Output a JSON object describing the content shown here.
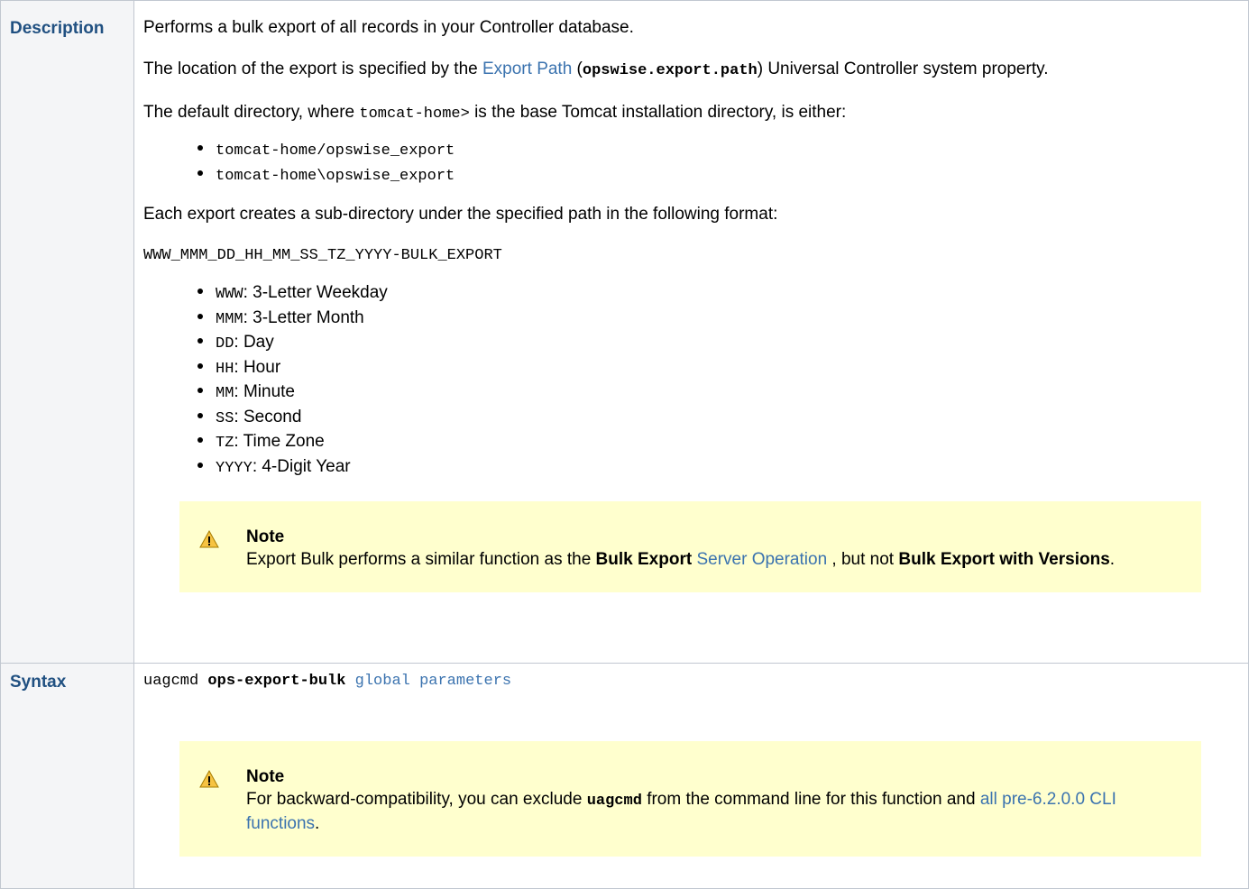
{
  "description": {
    "label": "Description",
    "intro": "Performs a bulk export of all records in your Controller database.",
    "location": {
      "before": "The location of the export is specified by the ",
      "link": "Export Path",
      "paren_open": " (",
      "property": "opswise.export.path",
      "after": ") Universal Controller system property."
    },
    "default_dir": {
      "before": "The default directory, where ",
      "code": "tomcat-home>",
      "after": " is the base Tomcat installation directory, is either:"
    },
    "paths": [
      "tomcat-home/opswise_export",
      "tomcat-home\\opswise_export"
    ],
    "format_intro": "Each export creates a sub-directory under the specified path in the following format:",
    "format": "WWW_MMM_DD_HH_MM_SS_TZ_YYYY-BULK_EXPORT",
    "fields": [
      {
        "code": "WWW",
        "text": ": 3-Letter Weekday"
      },
      {
        "code": "MMM",
        "text": ": 3-Letter Month"
      },
      {
        "code": "DD",
        "text": ": Day"
      },
      {
        "code": "HH",
        "text": ": Hour"
      },
      {
        "code": "MM",
        "text": ": Minute"
      },
      {
        "code": "SS",
        "text": ": Second"
      },
      {
        "code": "TZ",
        "text": ": Time Zone"
      },
      {
        "code": "YYYY",
        "text": ": 4-Digit Year"
      }
    ],
    "note": {
      "title": "Note",
      "t1": "Export Bulk performs a similar function as the ",
      "b1": "Bulk Export",
      "link": "Server Operation",
      "t2": " , but not ",
      "b2": "Bulk Export with Versions",
      "t3": "."
    }
  },
  "syntax": {
    "label": "Syntax",
    "cmd": "uagcmd",
    "subcmd": "ops-export-bulk",
    "link_global": "global",
    "link_params": "parameters",
    "note": {
      "title": "Note",
      "t1": "For backward-compatibility, you can exclude ",
      "code": "uagcmd",
      "t2": " from the command line for this function and ",
      "link": "all pre-6.2.0.0 CLI functions",
      "t3": "."
    }
  },
  "colors": {
    "label": "#205081",
    "link": "#3b73af",
    "note_bg": "#ffffce",
    "warning": "#f6c342"
  }
}
